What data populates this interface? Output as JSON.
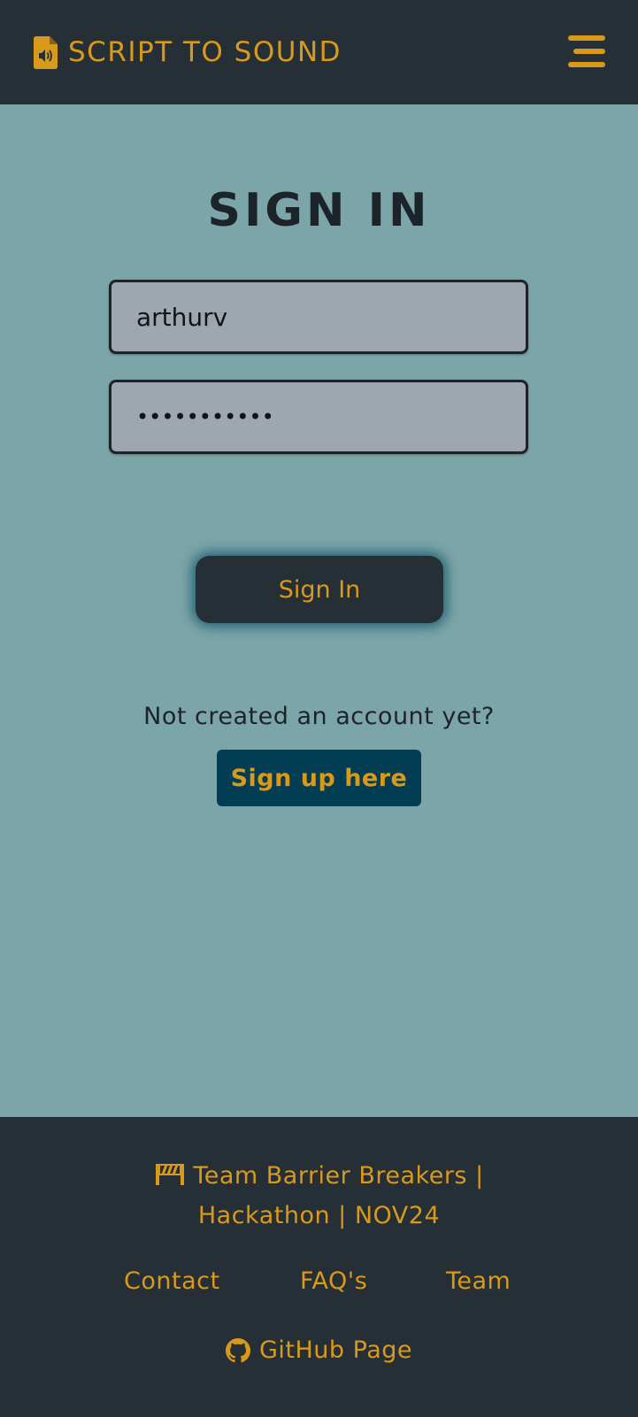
{
  "navbar": {
    "brand_label": "SCRIPT TO SOUND",
    "brand_icon": "file-audio-icon",
    "menu_icon": "hamburger-menu-icon"
  },
  "main": {
    "title": "SIGN IN",
    "username": {
      "value": "arthurv"
    },
    "password": {
      "value": "•••••••••••"
    },
    "signin_label": "Sign In",
    "prompt_text": "Not created an account yet?",
    "signup_label": "Sign up here"
  },
  "footer": {
    "credit_icon": "roadblock-icon",
    "credit_line1": "Team Barrier Breakers |",
    "credit_line2": "Hackathon | NOV24",
    "links": [
      {
        "label": "Contact"
      },
      {
        "label": "FAQ's"
      },
      {
        "label": "Team"
      }
    ],
    "github_icon": "github-icon",
    "github_label": "GitHub Page"
  },
  "colors": {
    "navbar_bg": "#262e36",
    "page_bg": "#7ca5a9",
    "accent": "#d89a1a",
    "input_bg": "#9ea6b0",
    "signup_bg": "#033d54"
  }
}
